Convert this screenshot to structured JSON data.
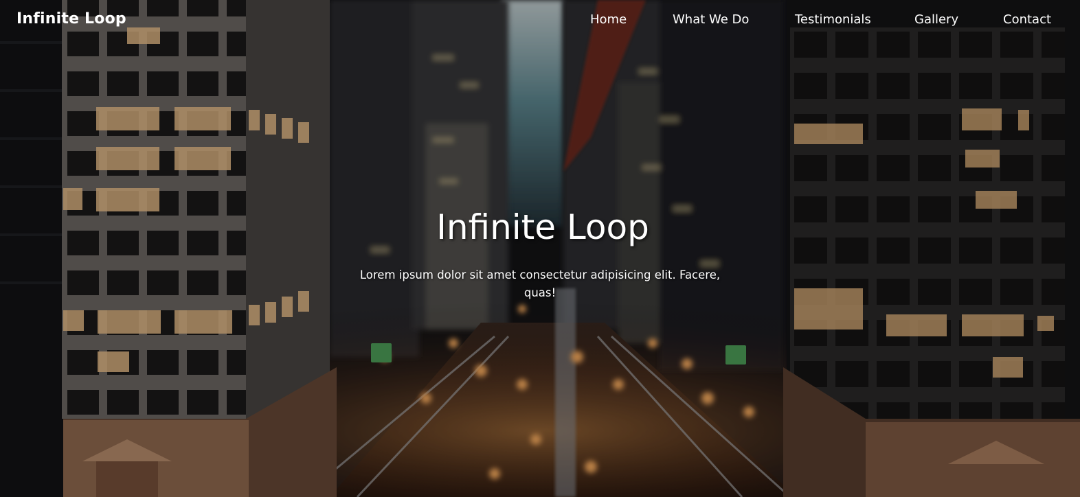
{
  "navbar": {
    "brand": "Infinite Loop",
    "links": [
      "Home",
      "What We Do",
      "Testimonials",
      "Gallery",
      "Contact"
    ]
  },
  "hero": {
    "title": "Infinite Loop",
    "subtitle": "Lorem ipsum dolor sit amet consectetur adipisicing elit. Facere, quas!",
    "background_icon": "city-street-night-photo"
  },
  "colors": {
    "text": "#ffffff",
    "sky": "#5f8a93",
    "city_glow": "#f0a050",
    "building_dark": "#1a1a1d"
  }
}
